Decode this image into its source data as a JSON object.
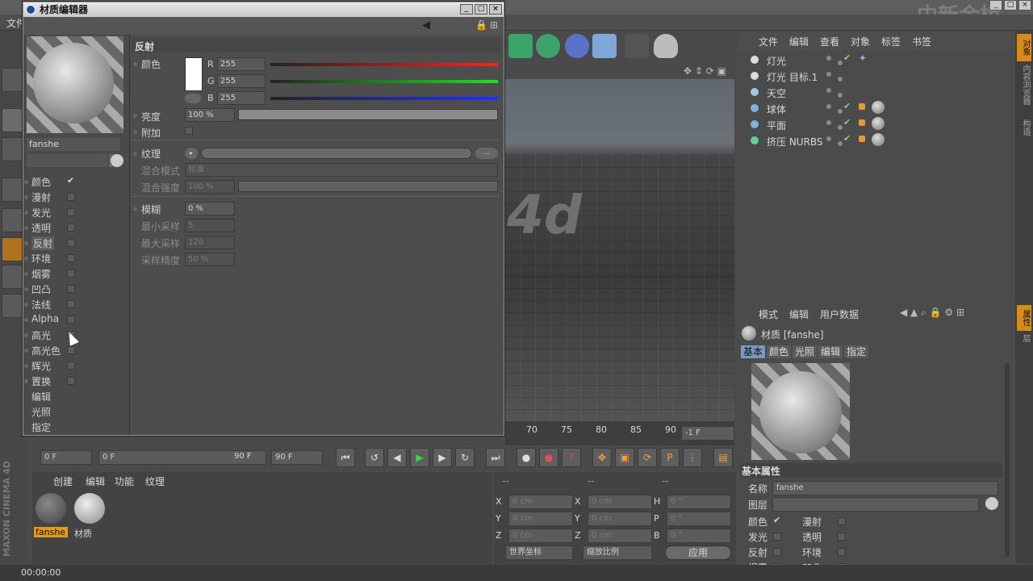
{
  "app": {
    "menu_first": "文件",
    "watermark": "中新金桥"
  },
  "material_editor": {
    "title": "材质编辑器",
    "material_name": "fanshe",
    "channels": [
      {
        "label": "颜色",
        "checked": true
      },
      {
        "label": "漫射",
        "checked": false
      },
      {
        "label": "发光",
        "checked": false
      },
      {
        "label": "透明",
        "checked": false
      },
      {
        "label": "反射",
        "checked": false
      },
      {
        "label": "环境",
        "checked": false
      },
      {
        "label": "烟雾",
        "checked": false
      },
      {
        "label": "凹凸",
        "checked": false
      },
      {
        "label": "法线",
        "checked": false
      },
      {
        "label": "Alpha",
        "checked": false
      },
      {
        "label": "高光",
        "checked": false
      },
      {
        "label": "高光色",
        "checked": false
      },
      {
        "label": "辉光",
        "checked": false
      },
      {
        "label": "置换",
        "checked": false
      }
    ],
    "extra_items": [
      "编辑",
      "光照",
      "指定"
    ],
    "section_title": "反射",
    "color_label": "颜色",
    "r_label": "R",
    "r_value": "255",
    "g_label": "G",
    "g_value": "255",
    "b_label": "B",
    "b_value": "255",
    "brightness_label": "亮度",
    "brightness_value": "100 %",
    "add_label": "附加",
    "texture_label": "纹理",
    "texture_more": "...",
    "blend_mode_label": "混合模式",
    "blend_mode_value": "标准",
    "blend_strength_label": "混合强度",
    "blend_strength_value": "100 %",
    "blur_label": "模糊",
    "blur_value": "0 %",
    "min_samples_label": "最小采样",
    "min_samples_value": "5",
    "max_samples_label": "最大采样",
    "max_samples_value": "128",
    "sample_accuracy_label": "采样精度",
    "sample_accuracy_value": "50 %"
  },
  "viewport": {
    "text": "4d"
  },
  "timeline": {
    "ticks": [
      "70",
      "75",
      "80",
      "85",
      "90"
    ],
    "frame_field": "-1 F"
  },
  "transport": {
    "start": "0 F",
    "range_start": "0 F",
    "range_end": "90 F",
    "end": "90 F"
  },
  "material_manager": {
    "menu": [
      "创建",
      "编辑",
      "功能",
      "纹理"
    ],
    "materials": [
      {
        "name": "fanshe",
        "selected": true
      },
      {
        "name": "材质",
        "selected": false
      }
    ],
    "brand": "MAXON CINEMA 4D"
  },
  "coords": {
    "headers": [
      "--",
      "--",
      "--"
    ],
    "rows": [
      {
        "a": "X",
        "av": "0 cm",
        "b": "X",
        "bv": "0 cm",
        "c": "H",
        "cv": "0 °"
      },
      {
        "a": "Y",
        "av": "0 cm",
        "b": "Y",
        "bv": "0 cm",
        "c": "P",
        "cv": "0 °"
      },
      {
        "a": "Z",
        "av": "0 cm",
        "b": "Z",
        "bv": "0 cm",
        "c": "B",
        "cv": "0 °"
      }
    ],
    "world_coords": "世界坐标",
    "scale": "缩放比例",
    "apply": "应用"
  },
  "object_manager": {
    "menu": [
      "文件",
      "编辑",
      "查看",
      "对象",
      "标签",
      "书签"
    ],
    "objects": [
      {
        "name": "灯光",
        "color": "#dddddd"
      },
      {
        "name": "灯光 目标.1",
        "color": "#dddddd"
      },
      {
        "name": "天空",
        "color": "#9fc7e8"
      },
      {
        "name": "球体",
        "color": "#7fb3e0"
      },
      {
        "name": "平面",
        "color": "#7fb3e0"
      },
      {
        "name": "挤压 NURBS",
        "color": "#5fcf9f"
      }
    ]
  },
  "attributes": {
    "menu": [
      "模式",
      "编辑",
      "用户数据"
    ],
    "material_title": "材质 [fanshe]",
    "tabs": [
      "基本",
      "颜色",
      "光照",
      "编辑",
      "指定"
    ],
    "section": "基本属性",
    "name_label": "名称",
    "name_value": "fanshe",
    "layer_label": "图层",
    "props": [
      {
        "label": "颜色",
        "checked": true
      },
      {
        "label": "漫射",
        "checked": false
      },
      {
        "label": "发光",
        "checked": false
      },
      {
        "label": "透明",
        "checked": false
      },
      {
        "label": "反射",
        "checked": false
      },
      {
        "label": "环境",
        "checked": false
      },
      {
        "label": "烟雾",
        "checked": false
      },
      {
        "label": "凹凸",
        "checked": false
      }
    ]
  },
  "side_tabs": [
    "对象",
    "内容浏览器",
    "构造",
    "属性",
    "层"
  ],
  "status": {
    "time": "00:00:00"
  }
}
